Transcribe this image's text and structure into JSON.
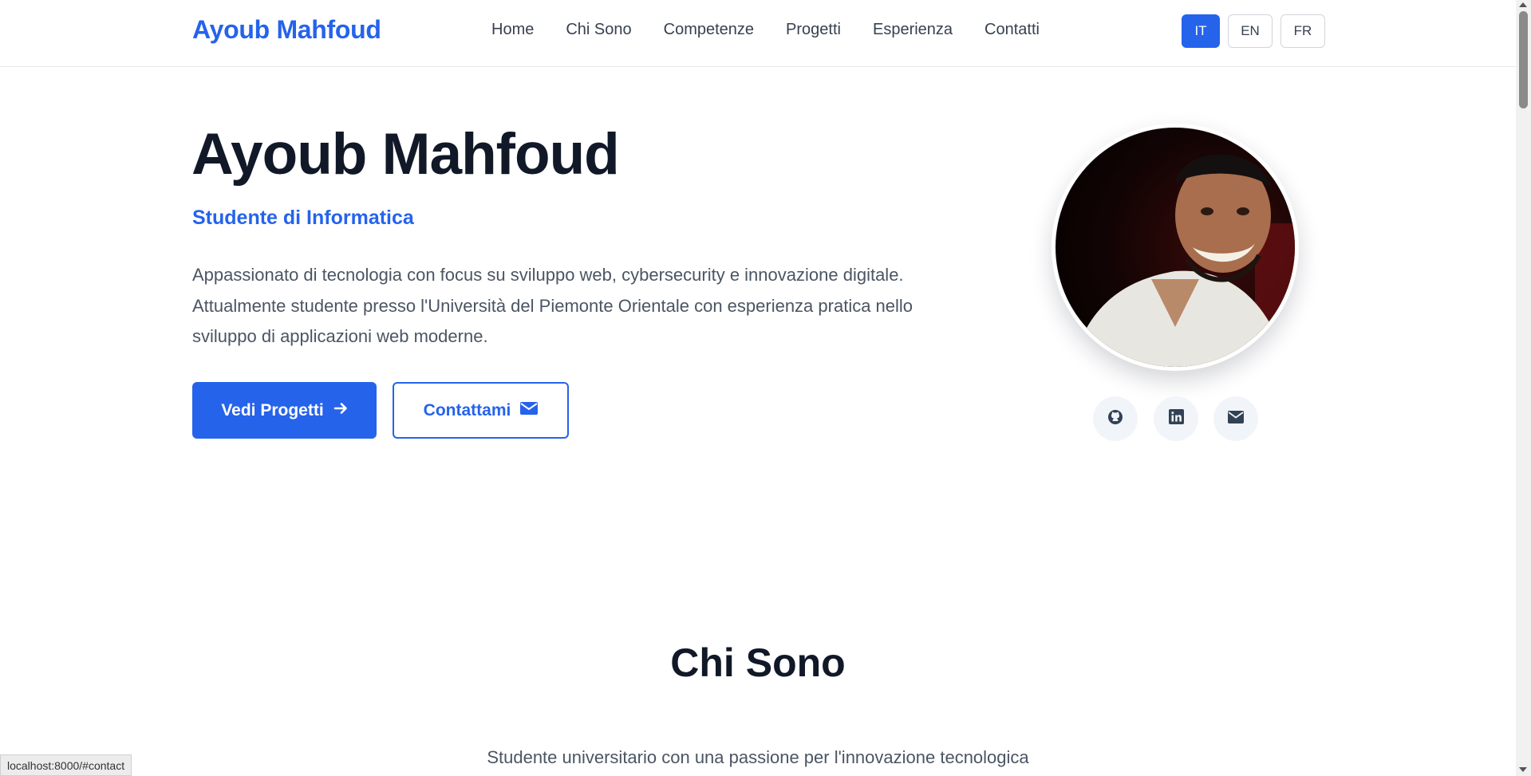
{
  "nav": {
    "brand": "Ayoub Mahfoud",
    "links": [
      "Home",
      "Chi Sono",
      "Competenze",
      "Progetti",
      "Esperienza",
      "Contatti"
    ],
    "languages": [
      "IT",
      "EN",
      "FR"
    ],
    "active_language": "IT"
  },
  "hero": {
    "name": "Ayoub Mahfoud",
    "subtitle": "Studente di Informatica",
    "description": "Appassionato di tecnologia con focus su sviluppo web, cybersecurity e innovazione digitale. Attualmente studente presso l'Università del Piemonte Orientale con esperienza pratica nello sviluppo di applicazioni web moderne.",
    "primary_button": "Vedi Progetti",
    "primary_button_icon": "arrow-right-icon",
    "secondary_button": "Contattami",
    "secondary_button_icon": "envelope-icon",
    "social_icons": [
      "github-icon",
      "linkedin-icon",
      "envelope-icon"
    ]
  },
  "about": {
    "title": "Chi Sono",
    "description": "Studente universitario con una passione per l'innovazione tecnologica"
  },
  "status_bar": {
    "url": "localhost:8000/#contact"
  },
  "colors": {
    "accent": "#2563eb",
    "heading": "#111827",
    "body_text": "#4b5563"
  }
}
